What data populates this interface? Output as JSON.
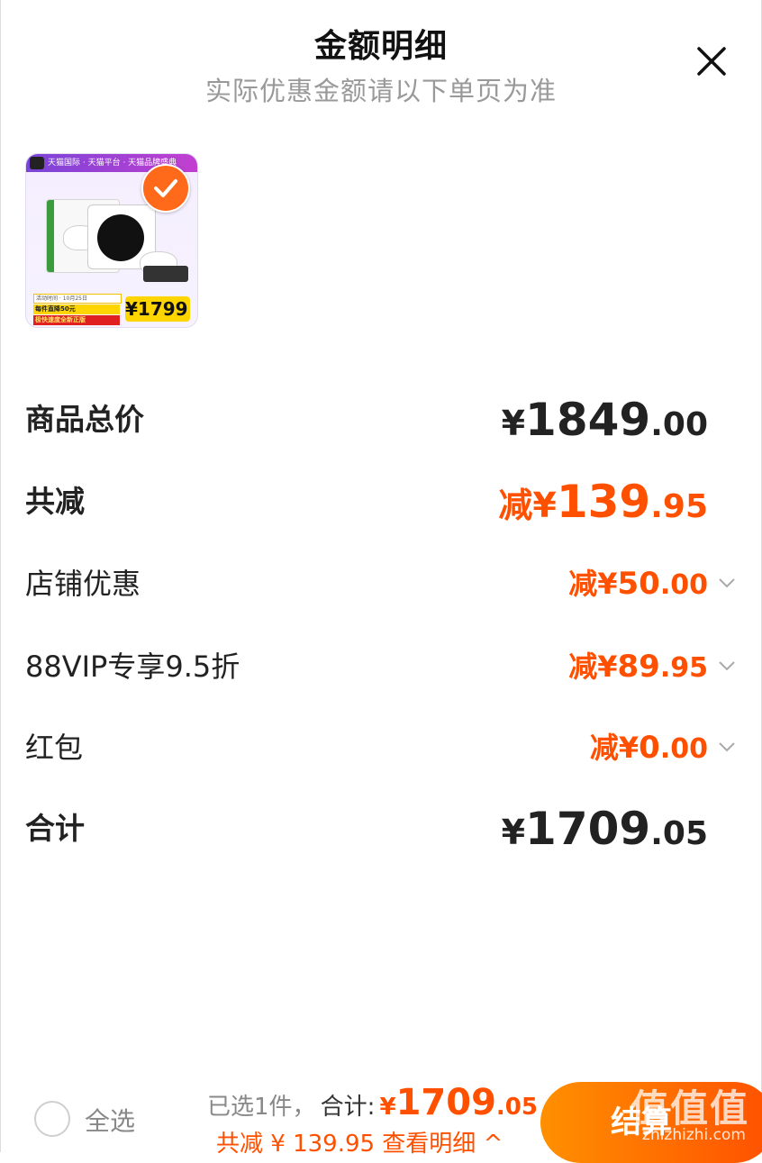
{
  "header": {
    "title": "金额明细",
    "subtitle": "实际优惠金额请以下单页为准"
  },
  "product": {
    "image_top_banner": "天猫国际 · 天猫平台 · 天猫品牌盛典",
    "image_strip_1": "活动时间 · 10月25日",
    "image_strip_2": "每件直降50元",
    "image_strip_3": "极快速度全新正版",
    "image_price": "1799",
    "selected": true
  },
  "summary": {
    "total_price": {
      "label": "商品总价",
      "yen": "¥",
      "int": "1849",
      "dec": ".00"
    },
    "total_discount": {
      "label": "共减",
      "prefix": "减¥",
      "int": "139",
      "dec": ".95"
    },
    "discounts": [
      {
        "label": "店铺优惠",
        "prefix": "减¥",
        "int": "50",
        "dec": ".00"
      },
      {
        "label": "88VIP专享9.5折",
        "prefix": "减¥",
        "int": "89",
        "dec": ".95"
      },
      {
        "label": "红包",
        "prefix": "减¥",
        "int": "0",
        "dec": ".00"
      }
    ],
    "grand_total": {
      "label": "合计",
      "yen": "¥",
      "int": "1709",
      "dec": ".05"
    }
  },
  "footer": {
    "select_all": "全选",
    "selected_count": "已选1件，",
    "total_label": "合计:",
    "total_yen": "¥",
    "total_int": "1709",
    "total_dec": ".05",
    "discount_line": "共减 ¥ 139.95  查看明细 ^",
    "checkout": "结算",
    "watermark": "值值值",
    "watermark_url": "zhizhizhi.com"
  },
  "colors": {
    "accent": "#ff5000",
    "checkout_gradient_start": "#ff9000",
    "text_dark": "#222222",
    "text_muted": "#999999"
  }
}
